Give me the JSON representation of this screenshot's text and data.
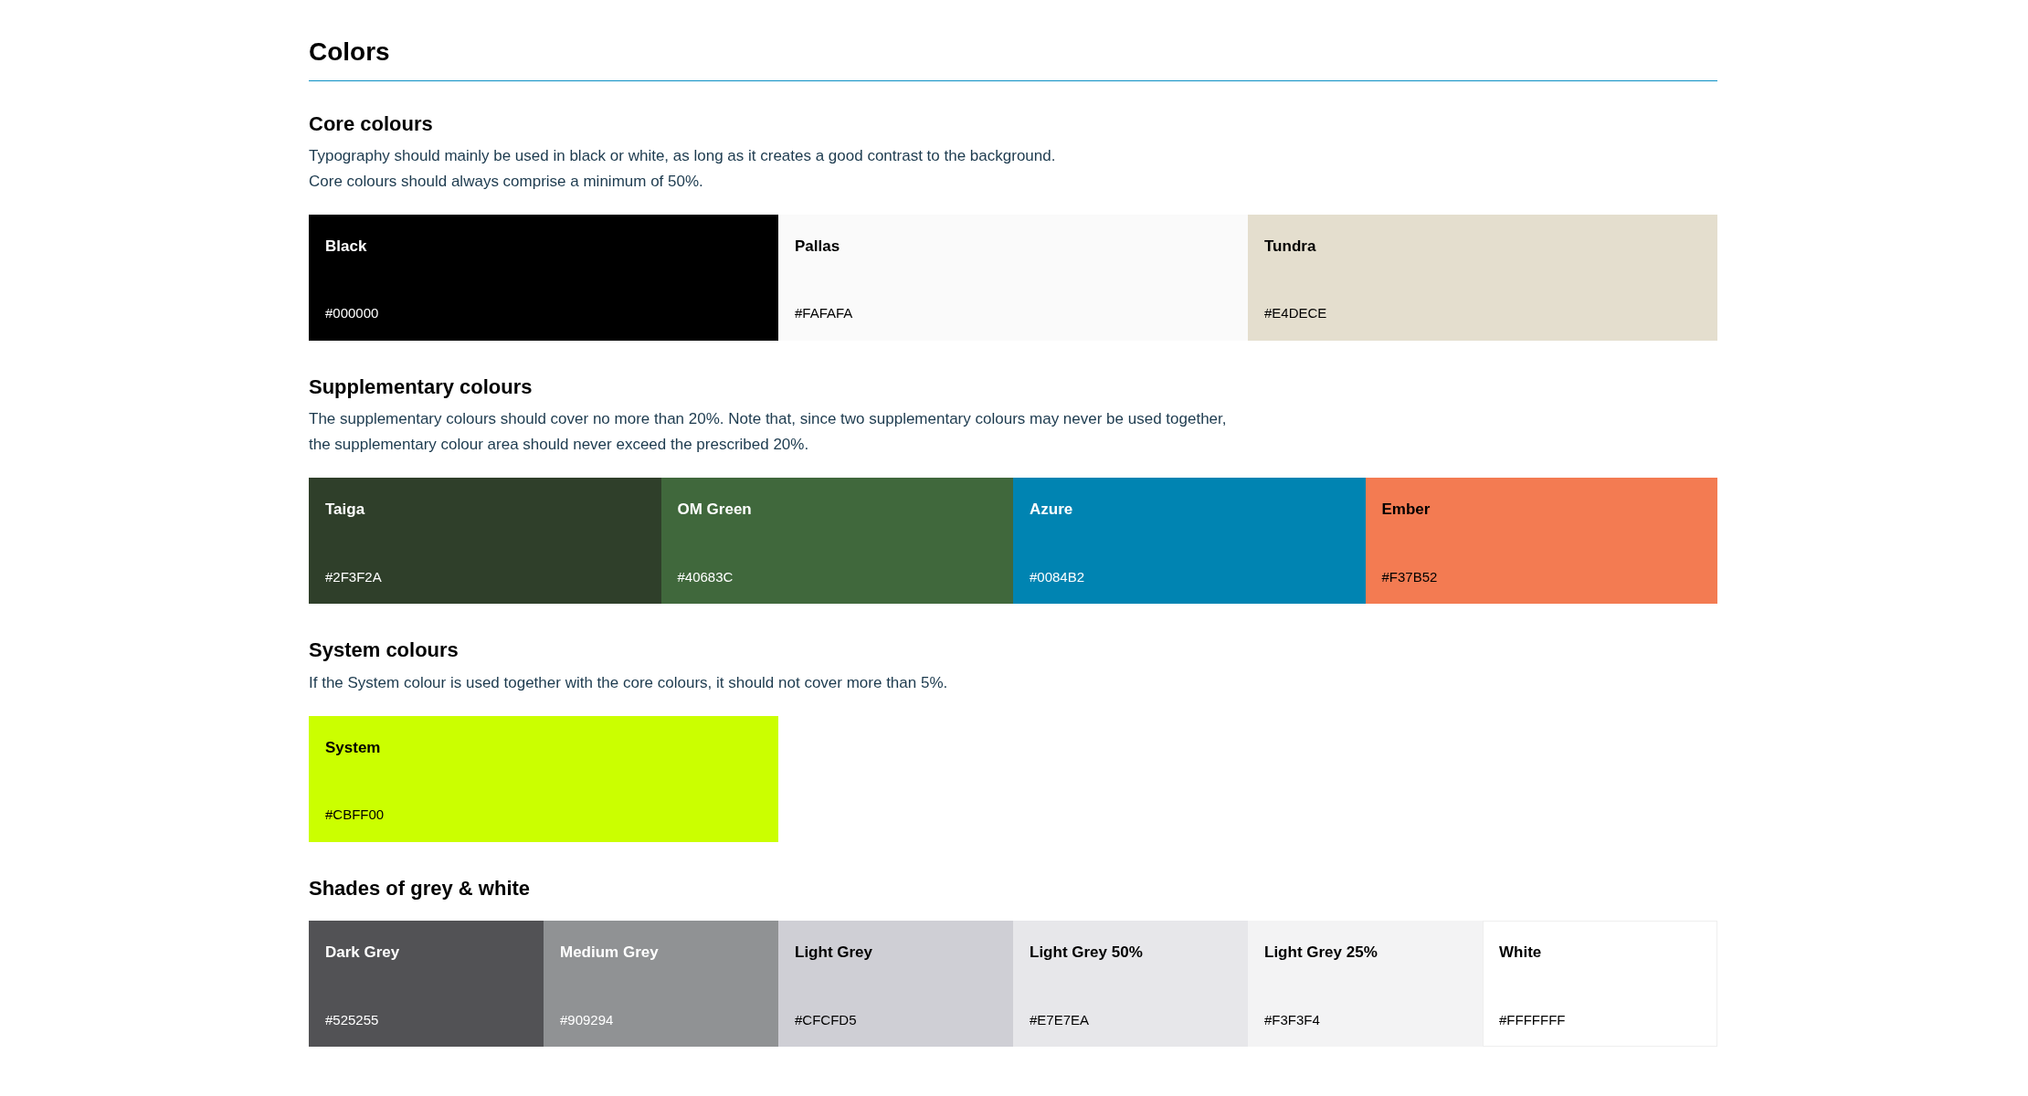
{
  "title": "Colors",
  "sections": [
    {
      "heading": "Core colours",
      "description": [
        "Typography should mainly be used in black or white, as long as it creates a good contrast to the background.",
        "Core colours should always comprise a minimum of 50%."
      ],
      "swatches": [
        {
          "name": "Black",
          "hex": "#000000",
          "color": "#000000"
        },
        {
          "name": "Pallas",
          "hex": "#FAFAFA",
          "color": "#fafafa"
        },
        {
          "name": "Tundra",
          "hex": "#E4DECE",
          "color": "#e4dece"
        }
      ]
    },
    {
      "heading": "Supplementary colours",
      "description": [
        "The supplementary colours should cover no more than 20%. Note that, since two supplementary colours may never be used together, the supplementary colour area should never exceed the prescribed 20%."
      ],
      "swatches": [
        {
          "name": "Taiga",
          "hex": "#2F3F2A",
          "color": "#2f3f2a"
        },
        {
          "name": "OM Green",
          "hex": "#40683C",
          "color": "#40683c"
        },
        {
          "name": "Azure",
          "hex": "#0084B2",
          "color": "#0084b2"
        },
        {
          "name": "Ember",
          "hex": "#F37B52",
          "color": "#f37b52"
        }
      ]
    },
    {
      "heading": "System colours",
      "description": [
        "If the System colour is used together with the core colours, it should not cover more than 5%."
      ],
      "swatches": [
        {
          "name": "System",
          "hex": "#CBFF00",
          "color": "#cbff00"
        }
      ]
    },
    {
      "heading": "Shades of grey & white",
      "swatches": [
        {
          "name": "Dark Grey",
          "hex": "#525255",
          "color": "#525255"
        },
        {
          "name": "Medium Grey",
          "hex": "#909294",
          "color": "#909294"
        },
        {
          "name": "Light Grey",
          "hex": "#CFCFD5",
          "color": "#cfcfd5"
        },
        {
          "name": "Light Grey 50%",
          "hex": "#E7E7EA",
          "color": "#e7e7ea"
        },
        {
          "name": "Light Grey 25%",
          "hex": "#F3F3F4",
          "color": "#f3f3f4"
        },
        {
          "name": "White",
          "hex": "#FFFFFFF",
          "color": "#ffffff"
        }
      ]
    }
  ]
}
